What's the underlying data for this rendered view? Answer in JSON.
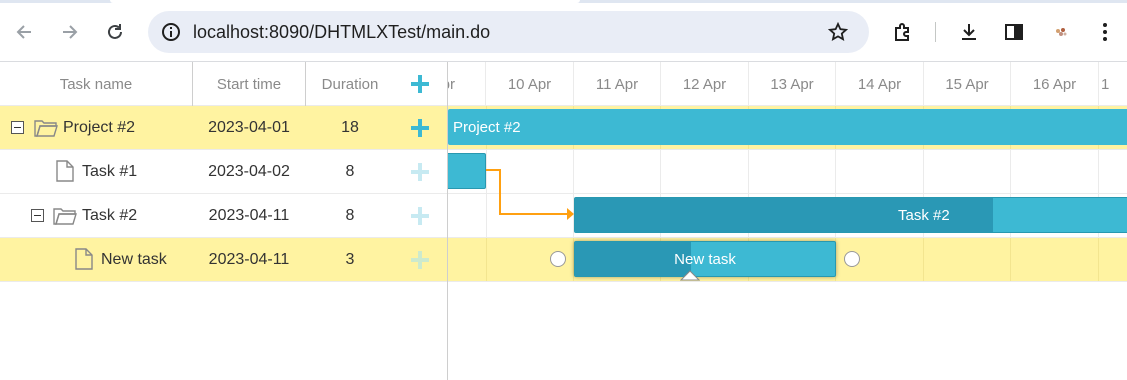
{
  "browser": {
    "url": "localhost:8090/DHTMLXTest/main.do",
    "icons": [
      "back-arrow-icon",
      "forward-arrow-icon",
      "reload-icon",
      "site-info-icon",
      "bookmark-star-icon",
      "extensions-icon",
      "download-icon",
      "side-panel-icon",
      "profile-icon",
      "menu-dots-icon"
    ]
  },
  "grid": {
    "columns": {
      "name": "Task name",
      "start": "Start time",
      "duration": "Duration"
    },
    "rows": [
      {
        "name": "Project #2",
        "start": "2023-04-01",
        "duration": "18"
      },
      {
        "name": "Task #1",
        "start": "2023-04-02",
        "duration": "8"
      },
      {
        "name": "Task #2",
        "start": "2023-04-11",
        "duration": "8"
      },
      {
        "name": "New task",
        "start": "2023-04-11",
        "duration": "3"
      }
    ]
  },
  "scale": [
    "Apr",
    "10 Apr",
    "11 Apr",
    "12 Apr",
    "13 Apr",
    "14 Apr",
    "15 Apr",
    "16 Apr",
    "1"
  ],
  "bars": {
    "project": "Project #2",
    "task2": "Task #2",
    "new_task": "New task"
  },
  "colors": {
    "bar": "#3db9d3",
    "progress": "#2a98b5",
    "selected_row": "#fff3a1",
    "link": "#ffa011",
    "add_icon": "#3db9d3"
  }
}
